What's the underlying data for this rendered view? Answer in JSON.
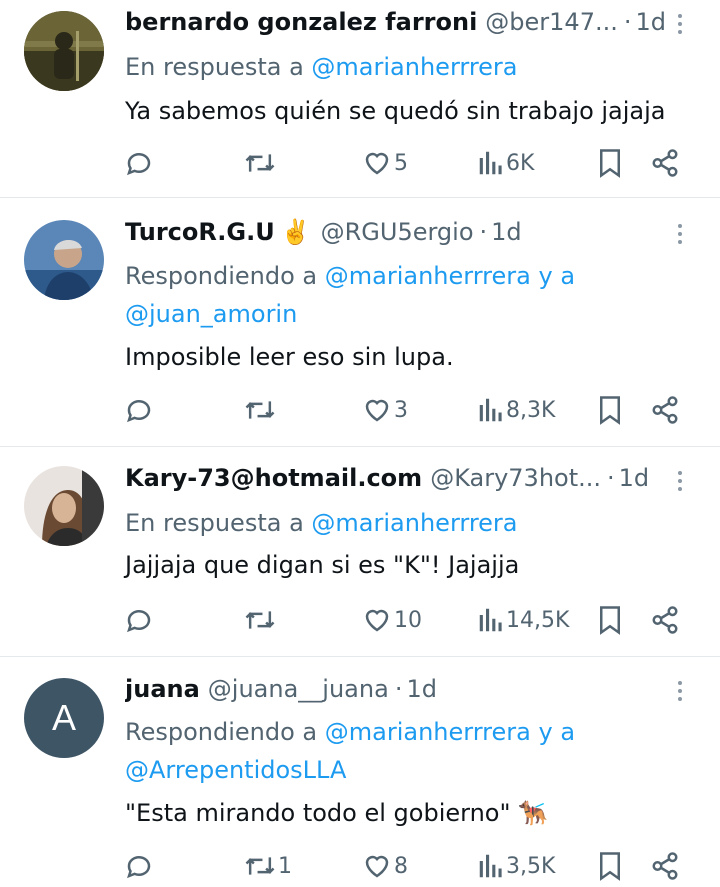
{
  "tweets": [
    {
      "name": "bernardo gonzalez farroni",
      "handle": "@ber147...",
      "time": "1d",
      "reply_prefix": "En respuesta a ",
      "reply_mentions": "@marianherrrera",
      "reply_line2": "",
      "text": "Ya sabemos quién se quedó sin trabajo jajaja",
      "replies": "",
      "retweets": "",
      "likes": "5",
      "views": "6K"
    },
    {
      "name": "TurcoR.G.U",
      "name_emoji": "✌️",
      "handle": "@RGU5ergio",
      "time": "1d",
      "reply_prefix": "Respondiendo a ",
      "reply_mentions": "@marianherrrera y a",
      "reply_line2": "@juan_amorin",
      "text": "Imposible leer eso sin lupa.",
      "replies": "",
      "retweets": "",
      "likes": "3",
      "views": "8,3K"
    },
    {
      "name": "Kary-73@hotmail.com",
      "handle": "@Kary73hot...",
      "time": "1d",
      "reply_prefix": "En respuesta a ",
      "reply_mentions": "@marianherrrera",
      "reply_line2": "",
      "text": "Jajjaja que digan si es \"K\"! Jajajja",
      "replies": "",
      "retweets": "",
      "likes": "10",
      "views": "14,5K"
    },
    {
      "name": "juana",
      "handle": "@juana__juana",
      "time": "1d",
      "avatar_letter": "A",
      "reply_prefix": "Respondiendo a ",
      "reply_mentions": "@marianherrrera y a",
      "reply_line2": "@ArrepentidosLLA",
      "text": "\"Esta mirando todo el gobierno\"",
      "text_emoji": "🐕‍🦺",
      "replies": "",
      "retweets": "1",
      "likes": "8",
      "views": "3,5K"
    }
  ],
  "separator": "·",
  "colors": {
    "accent": "#1d9bf0",
    "secondary": "#536471",
    "divider": "#e6e9ec"
  }
}
